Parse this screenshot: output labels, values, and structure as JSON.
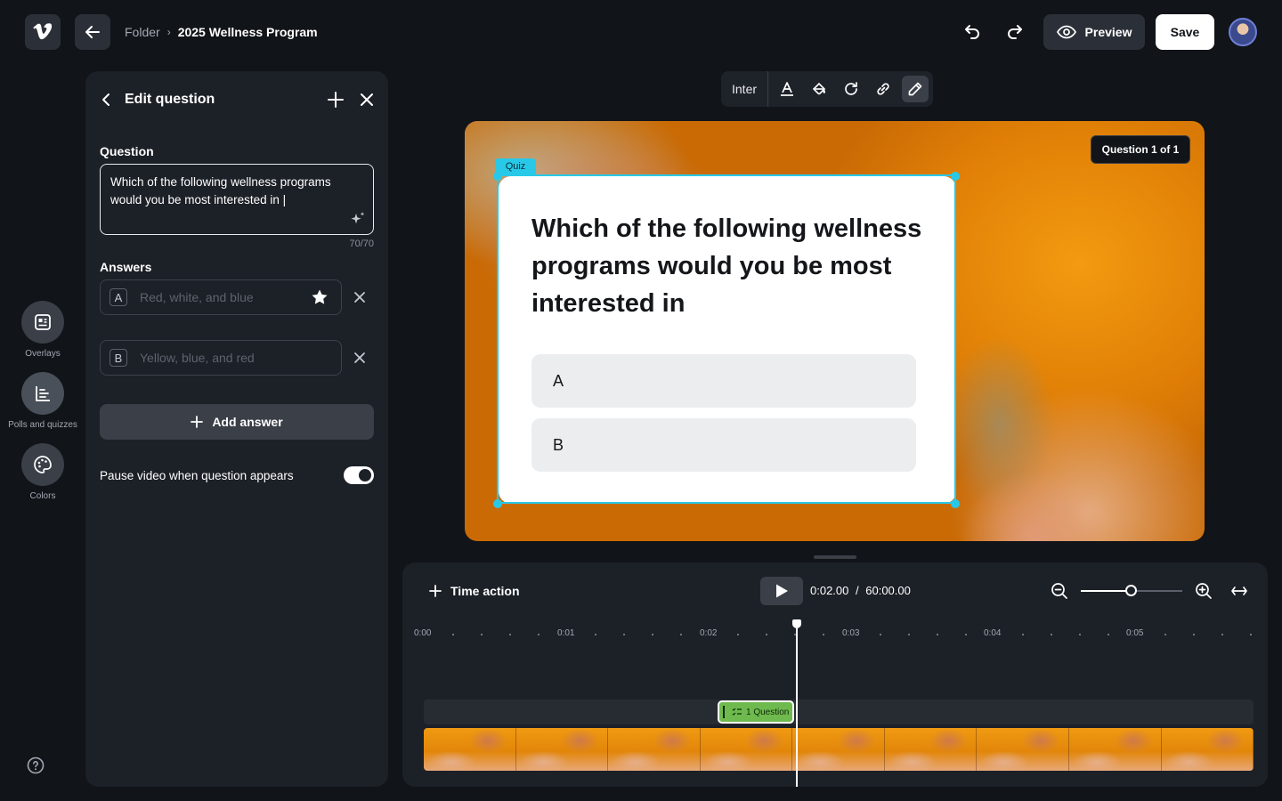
{
  "header": {
    "breadcrumb": [
      "Folder",
      "2025 Wellness Program"
    ],
    "breadcrumb_sep": "›",
    "preview_label": "Preview",
    "save_label": "Save"
  },
  "rail": {
    "items": [
      {
        "label": "Overlays",
        "icon": "overlays-icon"
      },
      {
        "label": "Polls and quizzes",
        "icon": "polls-icon",
        "active": true
      },
      {
        "label": "Colors",
        "icon": "palette-icon"
      }
    ]
  },
  "editor": {
    "title": "Edit question",
    "question_label": "Question",
    "question_value": "Which of the following wellness programs would you be most interested in |",
    "char_counter": "70/70",
    "answers_label": "Answers",
    "answers": [
      {
        "letter": "A",
        "placeholder": "Red, white, and blue",
        "correct": true
      },
      {
        "letter": "B",
        "placeholder": "Yellow, blue, and red",
        "correct": false
      }
    ],
    "add_answer_label": "Add answer",
    "pause_label": "Pause video when question appears",
    "pause_enabled": true
  },
  "toolbar": {
    "font": "Inter"
  },
  "canvas": {
    "question_badge": "Question 1 of 1",
    "quiz_tag": "Quiz",
    "question_text": "Which of the following wellness programs would you be most interested in",
    "options": [
      "A",
      "B"
    ]
  },
  "timeline": {
    "time_action_label": "Time action",
    "current_time": "0:02.00",
    "time_sep": "/",
    "total_time": "60:00.00",
    "zoom_level": 0.5,
    "ticks": [
      "0:00",
      "0:01",
      "0:02",
      "0:03",
      "0:04",
      "0:05"
    ],
    "clip_label": "1  Question"
  },
  "colors": {
    "accent_selection": "#28c9e8",
    "clip_green": "#6fba4e",
    "background": "#111418",
    "panel": "#1c2027"
  }
}
